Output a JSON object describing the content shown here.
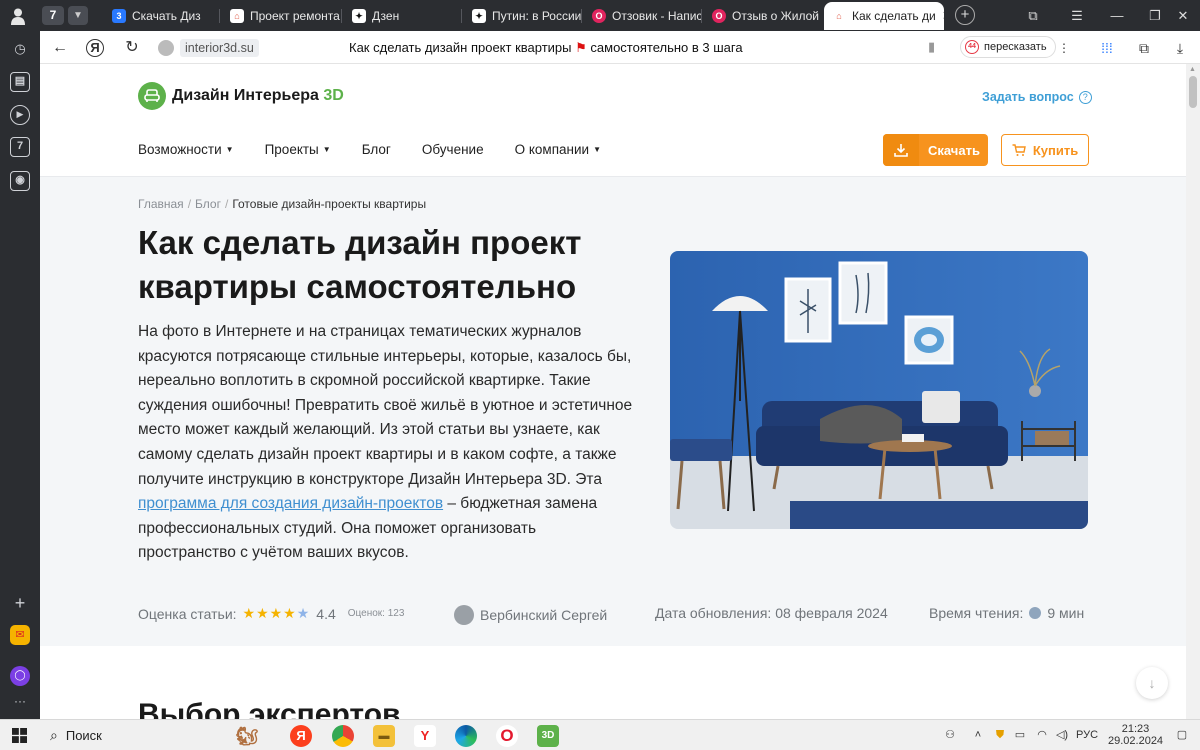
{
  "browser": {
    "tab_count": "7",
    "tabs": [
      {
        "title": "Скачать Диз",
        "favicon_color": "#2979ff",
        "favicon_glyph": "3"
      },
      {
        "title": "Проект ремонта",
        "favicon_color": "#e05a47",
        "favicon_glyph": "⌂"
      },
      {
        "title": "Дзен",
        "favicon_color": "#111111",
        "favicon_glyph": "✦"
      },
      {
        "title": "Путин: в России",
        "favicon_color": "#111111",
        "favicon_glyph": "✦"
      },
      {
        "title": "Отзовик - Напис",
        "favicon_color": "#e0245e",
        "favicon_glyph": "O"
      },
      {
        "title": "Отзыв о Жилой",
        "favicon_color": "#e0245e",
        "favicon_glyph": "O"
      },
      {
        "title": "Как сделать ди",
        "favicon_color": "#e05a47",
        "favicon_glyph": "⌂",
        "active": true
      }
    ],
    "address": {
      "host": "interior3d.su",
      "page_title_before_flag": "Как сделать дизайн проект квартиры",
      "page_title_after_flag": "самостоятельно в 3 шага",
      "retell_badge": "44",
      "retell_label": "пересказать"
    },
    "sidebar_badge": "7"
  },
  "site": {
    "logo_text": "Дизайн Интерьера",
    "logo_accent": "3D",
    "ask_question": "Задать вопрос",
    "nav": [
      {
        "label": "Возможности",
        "dropdown": true
      },
      {
        "label": "Проекты",
        "dropdown": true
      },
      {
        "label": "Блог",
        "dropdown": false
      },
      {
        "label": "Обучение",
        "dropdown": false
      },
      {
        "label": "О компании",
        "dropdown": true
      }
    ],
    "download_label": "Скачать",
    "buy_label": "Купить",
    "accent_color": "#f7931e",
    "brand_green": "#5db14a"
  },
  "article": {
    "breadcrumb": [
      "Главная",
      "Блог",
      "Готовые дизайн-проекты квартиры"
    ],
    "title": "Как сделать дизайн проект квартиры самостоятельно",
    "lead_before_link": "На фото в Интернете и на страницах тематических журналов красуются потрясающе стильные интерьеры, которые, казалось бы, нереально воплотить в скромной российской квартирке. Такие суждения ошибочны! Превратить своё жильё в уютное и эстетичное место может каждый желающий. Из этой статьи вы узнаете, как самому сделать дизайн проект квартиры и в каком софте, а также получите инструкцию в конструкторе Дизайн Интерьера 3D. Эта ",
    "lead_link": "программа для создания дизайн-проектов",
    "lead_after_link": " – бюджетная замена профессиональных студий. Она поможет организовать пространство с учётом ваших вкусов.",
    "rating_label": "Оценка статьи:",
    "rating_value": "4.4",
    "votes_label": "Оценок: 123",
    "author": "Вербинский Сергей",
    "updated_label": "Дата обновления: 08 февраля 2024",
    "reading_label": "Время чтения:",
    "reading_value": "9 мин",
    "next_heading": "Выбор экспертов"
  },
  "taskbar": {
    "search_label": "Поиск",
    "lang": "РУС",
    "time": "21:23",
    "date": "29.02.2024"
  }
}
